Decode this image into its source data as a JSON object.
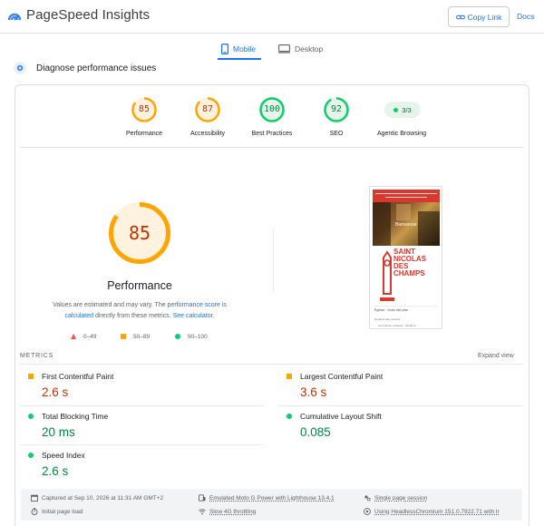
{
  "header": {
    "title": "PageSpeed Insights",
    "copy_link": "Copy Link",
    "docs": "Docs"
  },
  "tabs": [
    {
      "label": "Mobile",
      "icon": "smartphone-icon",
      "active": true
    },
    {
      "label": "Desktop",
      "icon": "monitor-icon",
      "active": false
    }
  ],
  "diagnose": {
    "title": "Diagnose performance issues"
  },
  "scores": [
    {
      "label": "Performance",
      "value": "85",
      "status": "average",
      "color": "#ffa400",
      "fraction": 0.85
    },
    {
      "label": "Accessibility",
      "value": "87",
      "status": "average",
      "color": "#ffa400",
      "fraction": 0.87
    },
    {
      "label": "Best Practices",
      "value": "100",
      "status": "pass",
      "color": "#0cce6b",
      "fraction": 1.0
    },
    {
      "label": "SEO",
      "value": "92",
      "status": "pass",
      "color": "#0cce6b",
      "fraction": 0.92
    }
  ],
  "agentic": {
    "value": "3/3",
    "label": "Agentic Browsing"
  },
  "performance": {
    "score": "85",
    "fraction": 0.85,
    "label": "Performance",
    "note_pre": "Values are estimated and may vary. The ",
    "note_link1": "performance score is calculated",
    "note_mid": " directly from these metrics. ",
    "note_link2": "See calculator."
  },
  "legend": [
    {
      "range": "0–49",
      "shape": "triangle",
      "color": "#ff4e42"
    },
    {
      "range": "50–89",
      "shape": "square",
      "color": "#ffa400"
    },
    {
      "range": "90–100",
      "shape": "circle",
      "color": "#0cce6b"
    }
  ],
  "screenshot": {
    "overlay_text": "Bienvenue",
    "logo_lines": [
      "SAINT",
      "NICOLAS",
      "DES",
      "CHAMPS"
    ],
    "row1": "Églises · Notre site plan",
    "row2": "Horaires des messes",
    "row3": "Au lundi au vendredi : 12h30 et"
  },
  "metrics": {
    "heading": "METRICS",
    "expand": "Expand view",
    "items": [
      {
        "label": "First Contentful Paint",
        "value": "2.6 s",
        "status": "average"
      },
      {
        "label": "Largest Contentful Paint",
        "value": "3.6 s",
        "status": "average"
      },
      {
        "label": "Total Blocking Time",
        "value": "20 ms",
        "status": "pass"
      },
      {
        "label": "Cumulative Layout Shift",
        "value": "0.085",
        "status": "pass"
      },
      {
        "label": "Speed Index",
        "value": "2.6 s",
        "status": "pass"
      }
    ]
  },
  "footer": {
    "captured": "Captured at Sep 10, 2026 at 11:31 AM GMT+2",
    "initial_load": "Initial page load",
    "device": "Emulated Moto G Power with Lighthouse 13.4.1",
    "throttling": "Slow 4G throttling",
    "session": "Single page session",
    "browser": "Using HeadlessChromium 151.0.7922.71 with lr"
  }
}
